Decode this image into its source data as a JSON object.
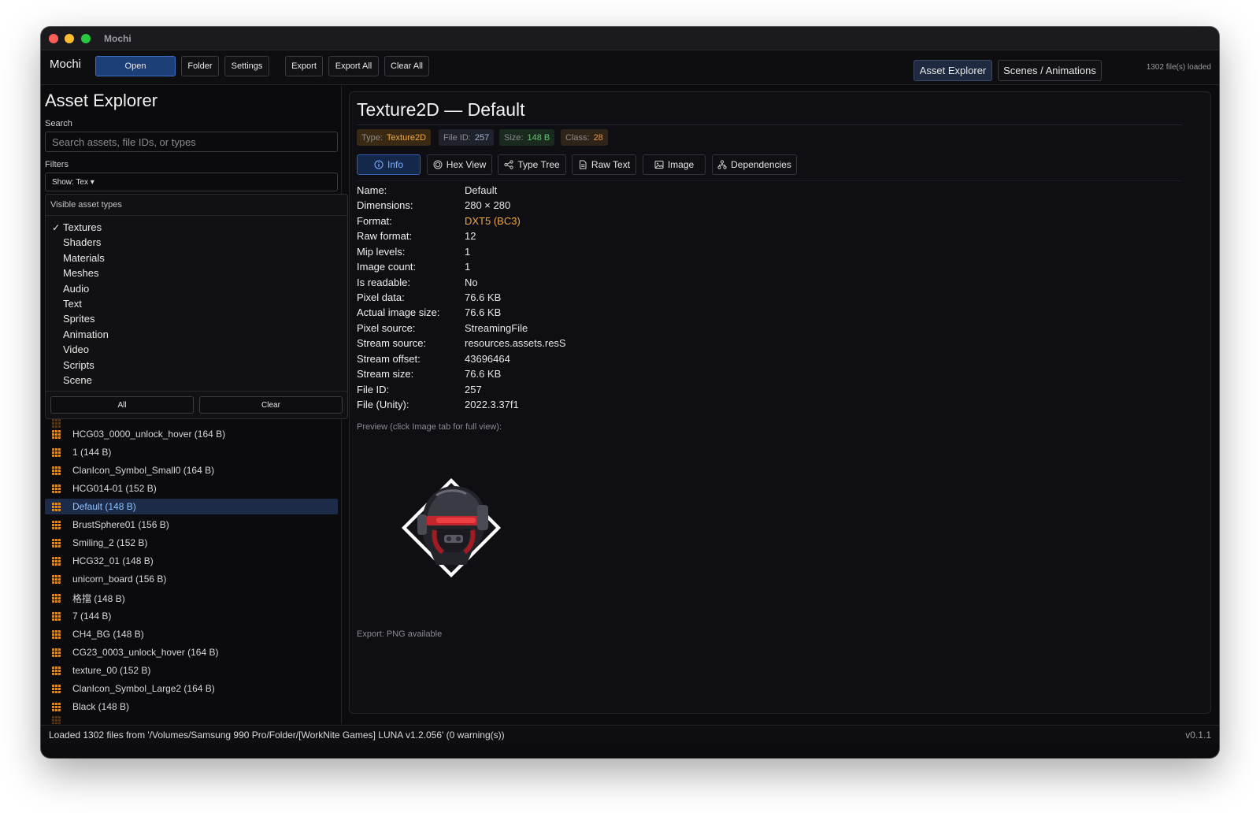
{
  "window": {
    "title": "Mochi"
  },
  "toolbar": {
    "app_name": "Mochi",
    "open": "Open",
    "folder": "Folder",
    "settings": "Settings",
    "export": "Export",
    "export_all": "Export All",
    "clear_all": "Clear All",
    "tab_asset_explorer": "Asset Explorer",
    "tab_scenes": "Scenes / Animations",
    "files_loaded": "1302 file(s) loaded"
  },
  "sidebar": {
    "title": "Asset Explorer",
    "search_label": "Search",
    "search_placeholder": "Search assets, file IDs, or types",
    "filters_label": "Filters",
    "filter_value": "Show: Tex ▾",
    "dropdown": {
      "header": "Visible asset types",
      "items": [
        {
          "label": "Textures",
          "checked": true
        },
        {
          "label": "Shaders",
          "checked": false
        },
        {
          "label": "Materials",
          "checked": false
        },
        {
          "label": "Meshes",
          "checked": false
        },
        {
          "label": "Audio",
          "checked": false
        },
        {
          "label": "Text",
          "checked": false
        },
        {
          "label": "Sprites",
          "checked": false
        },
        {
          "label": "Animation",
          "checked": false
        },
        {
          "label": "Video",
          "checked": false
        },
        {
          "label": "Scripts",
          "checked": false
        },
        {
          "label": "Scene",
          "checked": false
        }
      ],
      "all_button": "All",
      "clear_button": "Clear",
      "check_glyph": "✓"
    },
    "assets": [
      "HCG03_0000_unlock_hover (164 B)",
      "1 (144 B)",
      "ClanIcon_Symbol_Small0 (164 B)",
      "HCG014-01 (152 B)",
      "Default (148 B)",
      "BrustSphere01 (156 B)",
      "Smiling_2 (152 B)",
      "HCG32_01 (148 B)",
      "unicorn_board (156 B)",
      "格擋 (148 B)",
      "7 (144 B)",
      "CH4_BG (148 B)",
      "CG23_0003_unlock_hover (164 B)",
      "texture_00 (152 B)",
      "ClanIcon_Symbol_Large2 (164 B)",
      "Black (148 B)"
    ],
    "selected_index": 4
  },
  "main": {
    "title": "Texture2D — Default",
    "badges": {
      "type_key": "Type:",
      "type_val": "Texture2D",
      "fid_key": "File ID:",
      "fid_val": "257",
      "size_key": "Size:",
      "size_val": "148 B",
      "class_key": "Class:",
      "class_val": "28"
    },
    "tabs": {
      "info": "Info",
      "hex": "Hex View",
      "type_tree": "Type Tree",
      "raw_text": "Raw Text",
      "image": "Image",
      "deps": "Dependencies"
    },
    "info": [
      {
        "label": "Name:",
        "value": "Default"
      },
      {
        "label": "Dimensions:",
        "value": "280 × 280"
      },
      {
        "label": "Format:",
        "value": "DXT5 (BC3)"
      },
      {
        "label": "Raw format:",
        "value": "12"
      },
      {
        "label": "Mip levels:",
        "value": "1"
      },
      {
        "label": "Image count:",
        "value": "1"
      },
      {
        "label": "Is readable:",
        "value": "No"
      },
      {
        "label": "Pixel data:",
        "value": "76.6 KB"
      },
      {
        "label": "Actual image size:",
        "value": "76.6 KB"
      },
      {
        "label": "Pixel source:",
        "value": "StreamingFile"
      },
      {
        "label": "Stream source:",
        "value": "resources.assets.resS"
      },
      {
        "label": "Stream offset:",
        "value": "43696464"
      },
      {
        "label": "Stream size:",
        "value": "76.6 KB"
      },
      {
        "label": "File ID:",
        "value": "257"
      },
      {
        "label": "File (Unity):",
        "value": "2022.3.37f1"
      }
    ],
    "preview_note": "Preview (click Image tab for full view):",
    "export_note": "Export: PNG available"
  },
  "status": {
    "text": "Loaded 1302 files from '/Volumes/Samsung 990 Pro/Folder/[WorkNite Games] LUNA v1.2.056' (0 warning(s))",
    "version": "v0.1.1"
  }
}
